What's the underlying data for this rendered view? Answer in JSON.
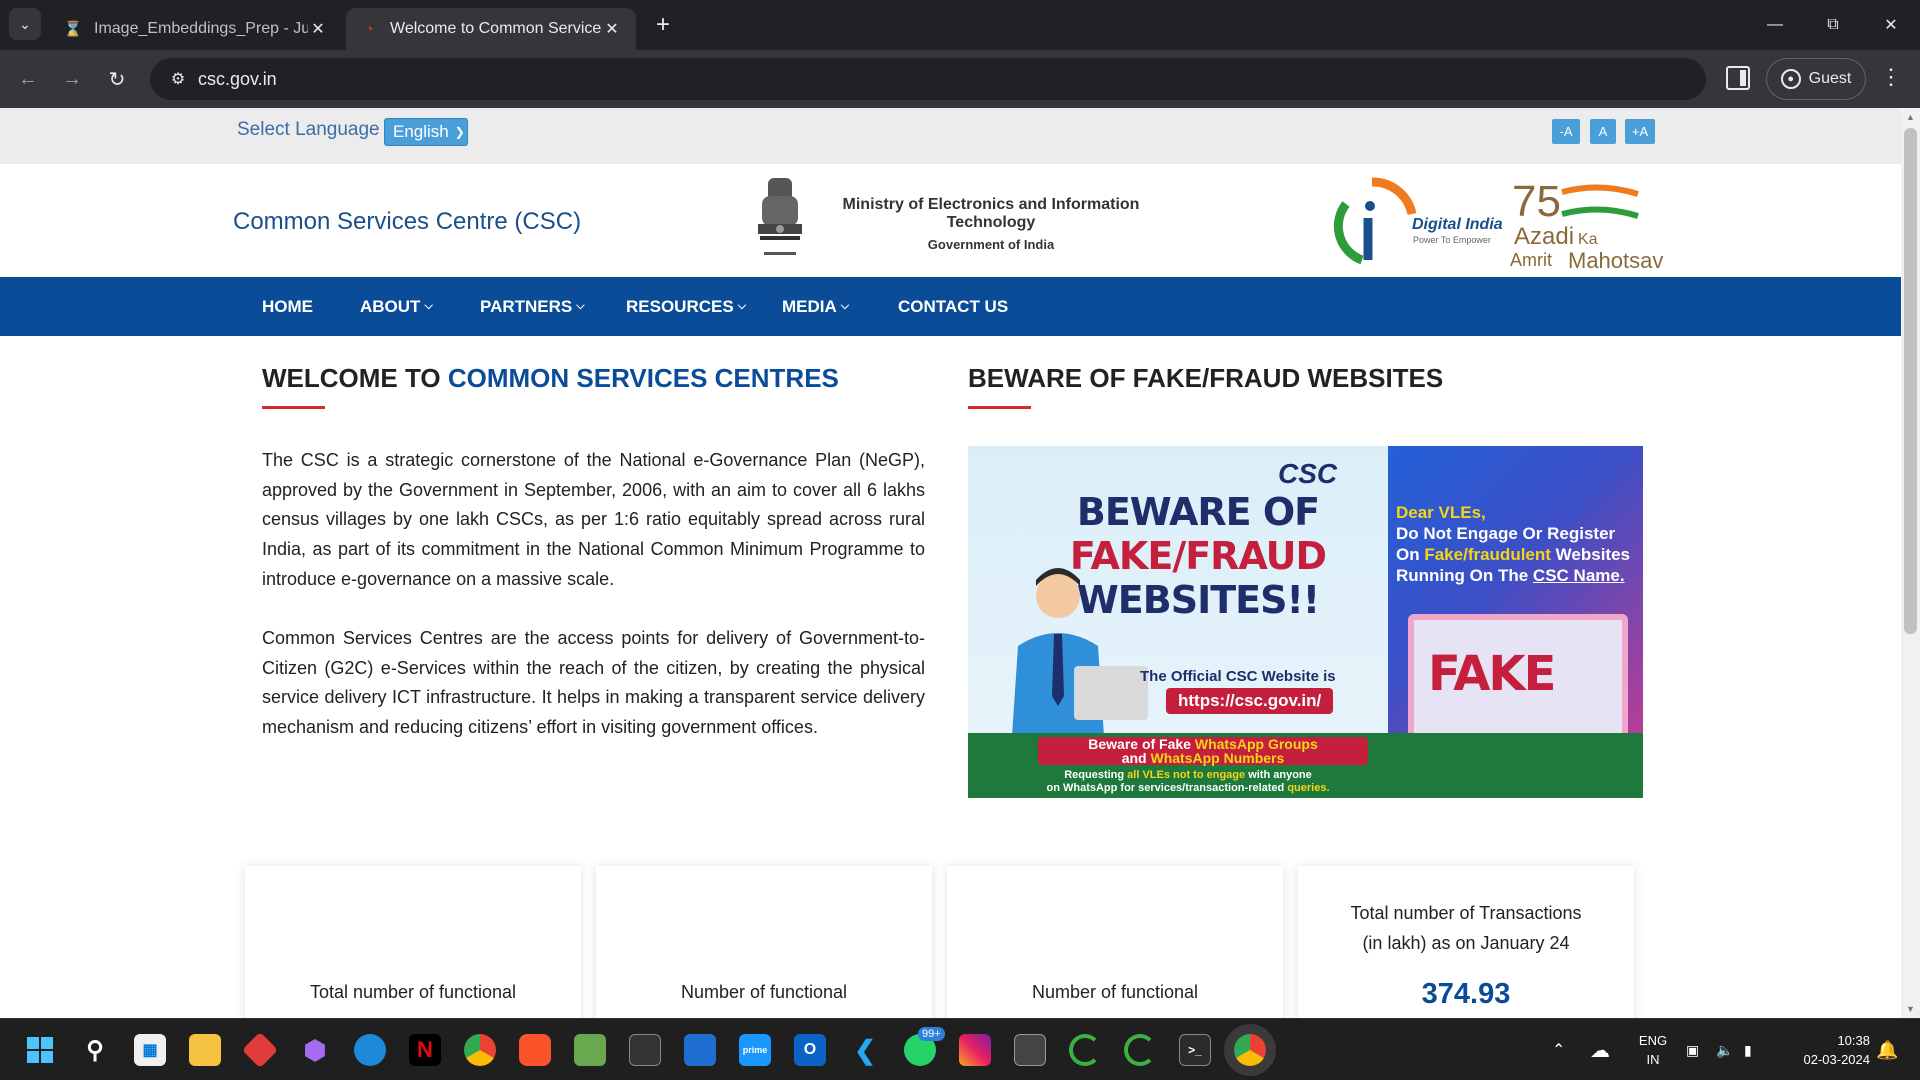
{
  "browser": {
    "tabs": [
      {
        "title": "Image_Embeddings_Prep - Jupy",
        "icon": "hourglass-icon"
      },
      {
        "title": "Welcome to Common Services",
        "icon": "csc-favicon-icon"
      }
    ],
    "url": "csc.gov.in",
    "profile_label": "Guest"
  },
  "page": {
    "lang_label": "Select Language :",
    "lang_value": "English",
    "font_buttons": [
      "-A",
      "A",
      "+A"
    ],
    "site_title": "Common Services Centre (CSC)",
    "ministry_line1": "Ministry of Electronics and Information Technology",
    "ministry_line2": "Government of India",
    "digital_india": "Digital India",
    "digital_india_tag": "Power To Empower",
    "aka_line1": "Azadi",
    "aka_ka": "Ka",
    "aka_line2": "Amrit",
    "aka_line3": "Mahotsav",
    "aka_num": "75",
    "nav": [
      "HOME",
      "ABOUT",
      "PARTNERS",
      "RESOURCES",
      "MEDIA",
      "CONTACT US"
    ],
    "welcome_prefix": "WELCOME TO ",
    "welcome_highlight": "COMMON SERVICES CENTRES",
    "beware_heading": "BEWARE OF FAKE/FRAUD WEBSITES",
    "para1": "The CSC is a strategic cornerstone of the National e-Governance Plan (NeGP), approved by the Government in September, 2006, with an aim to cover all 6 lakhs census villages by one lakh CSCs, as per 1:6 ratio equitably spread across rural India, as part of its commitment in the National Common Minimum Programme to introduce e-governance on a massive scale.",
    "para2": "Common Services Centres are the access points for delivery of Government-to-Citizen (G2C) e-Services within the reach of the citizen, by creating the physical service delivery ICT infrastructure. It helps in making a transparent service delivery mechanism and reducing citizens’ effort in visiting government offices.",
    "banner": {
      "csc": "CSC",
      "beware1": "BEWARE OF",
      "beware2": "FAKE/FRAUD",
      "beware3": "WEBSITES!!",
      "official": "The Official CSC Website is",
      "official_url": "https://csc.gov.in/",
      "dear1": "Dear VLEs,",
      "dear2": "Do Not Engage Or Register",
      "dear3a": "On ",
      "dear3b": "Fake/fraudulent",
      "dear3c": " Websites",
      "dear4a": "Running On The ",
      "dear4b": "CSC Name.",
      "fake": "FAKE",
      "wa1a": "Beware",
      "wa1b": " of Fake ",
      "wa1c": "WhatsApp Groups",
      "wa2a": "and ",
      "wa2b": "WhatsApp Numbers",
      "req1a": "Requesting ",
      "req1b": "all VLEs not to engage",
      "req1c": " with anyone",
      "req2a": "on WhatsApp for services/transaction-related ",
      "req2b": "queries."
    },
    "cards": [
      {
        "text": "Total number of functional",
        "value": ""
      },
      {
        "text": "Number of functional",
        "value": ""
      },
      {
        "text": "Number of functional",
        "value": ""
      },
      {
        "text_line1": "Total number of Transactions",
        "text_line2": "(in lakh) as on January 24",
        "value": "374.93"
      }
    ]
  },
  "taskbar": {
    "whatsapp_badge": "99+",
    "lang_line1": "ENG",
    "lang_line2": "IN",
    "time": "10:38",
    "date": "02-03-2024"
  },
  "colors": {
    "nav_bg": "#0b4c98",
    "accent_red": "#d62b2b",
    "link_blue": "#3a6ea5"
  }
}
